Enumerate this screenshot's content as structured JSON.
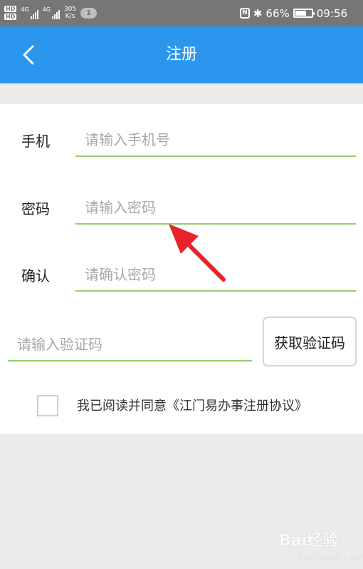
{
  "status_bar": {
    "hd1": "HD",
    "hd2": "HD",
    "net1": "4G",
    "net2": "4G",
    "speed_value": "305",
    "speed_unit": "K/s",
    "notification_count": "1",
    "nfc_letter": "N",
    "bluetooth": "✱",
    "battery": "66%",
    "battery_level": 0.66,
    "time": "09:56"
  },
  "header": {
    "title": "注册",
    "back_icon": "chevron-left-icon"
  },
  "form": {
    "phone": {
      "label": "手机",
      "placeholder": "请输入手机号"
    },
    "password": {
      "label": "密码",
      "placeholder": "请输入密码"
    },
    "confirm": {
      "label": "确认",
      "placeholder": "请确认密码"
    },
    "code": {
      "placeholder": "请输入验证码",
      "button": "获取验证码"
    },
    "agreement": {
      "checked": false,
      "text": "我已阅读并同意《江门易办事注册协议》"
    }
  },
  "watermark": {
    "text": "Bai经验",
    "sub": "jingyan.baidu.com"
  },
  "colors": {
    "header": "#2b96ed",
    "underline": "#8fd06a",
    "arrow": "#e6232a",
    "status_bar": "#767676"
  }
}
